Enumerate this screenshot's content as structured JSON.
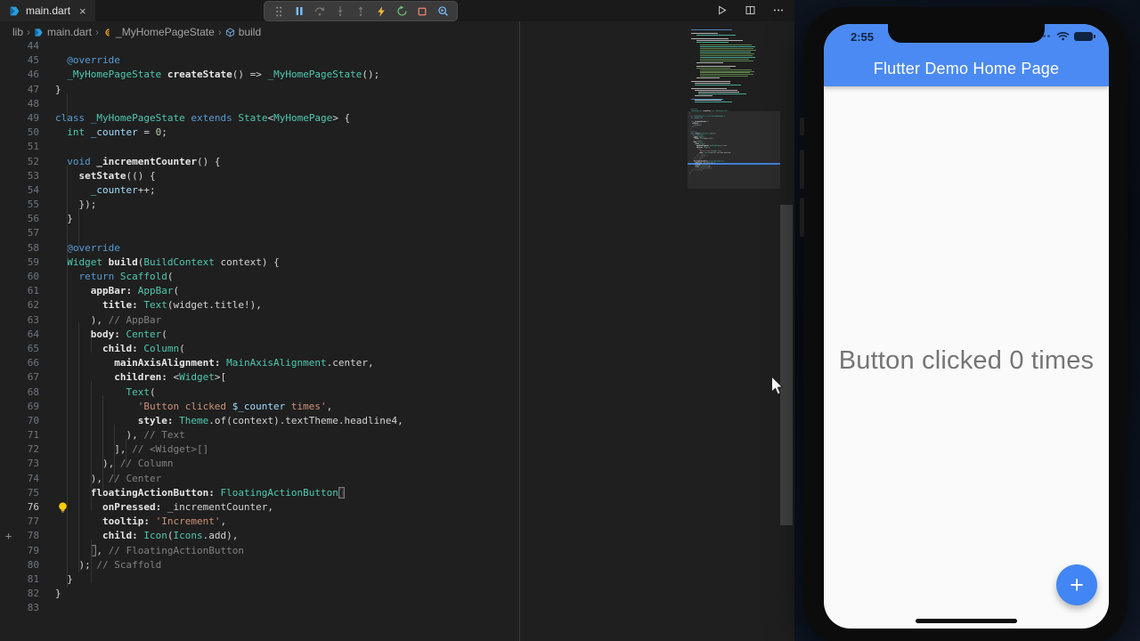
{
  "editor": {
    "tab": {
      "title": "main.dart",
      "close_label": "×"
    },
    "breadcrumbs": {
      "items": [
        "lib",
        "main.dart",
        "_MyHomePageState",
        "build"
      ],
      "separator": "›"
    },
    "debug_toolbar": {
      "buttons": [
        "drag-grip",
        "pause",
        "step-over",
        "step-into",
        "step-out",
        "hot-reload",
        "restart",
        "stop",
        "inspect-widget"
      ]
    },
    "header_actions": [
      "run",
      "split-editor",
      "more-actions"
    ],
    "gutter": {
      "plus_marker_line": 78,
      "lightbulb_line": 76,
      "active_line": 76
    },
    "code_lines": [
      {
        "n": 44,
        "t": []
      },
      {
        "n": 45,
        "t": [
          [
            "p",
            "  "
          ],
          [
            "k",
            "@override"
          ]
        ]
      },
      {
        "n": 46,
        "t": [
          [
            "p",
            "  "
          ],
          [
            "t",
            "_MyHomePageState"
          ],
          [
            "p",
            " "
          ],
          [
            "m",
            "createState"
          ],
          [
            "p",
            "() => "
          ],
          [
            "t",
            "_MyHomePageState"
          ],
          [
            "p",
            "();"
          ]
        ]
      },
      {
        "n": 47,
        "t": [
          [
            "p",
            "}"
          ]
        ]
      },
      {
        "n": 48,
        "t": []
      },
      {
        "n": 49,
        "t": [
          [
            "k",
            "class"
          ],
          [
            "p",
            " "
          ],
          [
            "t",
            "_MyHomePageState"
          ],
          [
            "p",
            " "
          ],
          [
            "k",
            "extends"
          ],
          [
            "p",
            " "
          ],
          [
            "t",
            "State"
          ],
          [
            "p",
            "<"
          ],
          [
            "t",
            "MyHomePage"
          ],
          [
            "p",
            "> {"
          ]
        ]
      },
      {
        "n": 50,
        "t": [
          [
            "p",
            "  "
          ],
          [
            "t",
            "int"
          ],
          [
            "p",
            " "
          ],
          [
            "v",
            "_counter"
          ],
          [
            "p",
            " = "
          ],
          [
            "num",
            "0"
          ],
          [
            "p",
            ";"
          ]
        ]
      },
      {
        "n": 51,
        "t": []
      },
      {
        "n": 52,
        "t": [
          [
            "p",
            "  "
          ],
          [
            "k",
            "void"
          ],
          [
            "p",
            " "
          ],
          [
            "m",
            "_incrementCounter"
          ],
          [
            "p",
            "() {"
          ]
        ]
      },
      {
        "n": 53,
        "t": [
          [
            "p",
            "    "
          ],
          [
            "m",
            "setState"
          ],
          [
            "p",
            "(() {"
          ]
        ]
      },
      {
        "n": 54,
        "t": [
          [
            "p",
            "      "
          ],
          [
            "v",
            "_counter"
          ],
          [
            "p",
            "++;"
          ]
        ]
      },
      {
        "n": 55,
        "t": [
          [
            "p",
            "    });"
          ]
        ]
      },
      {
        "n": 56,
        "t": [
          [
            "p",
            "  }"
          ]
        ]
      },
      {
        "n": 57,
        "t": []
      },
      {
        "n": 58,
        "t": [
          [
            "p",
            "  "
          ],
          [
            "k",
            "@override"
          ]
        ]
      },
      {
        "n": 59,
        "t": [
          [
            "p",
            "  "
          ],
          [
            "t",
            "Widget"
          ],
          [
            "p",
            " "
          ],
          [
            "m",
            "build"
          ],
          [
            "p",
            "("
          ],
          [
            "t",
            "BuildContext"
          ],
          [
            "p",
            " context) {"
          ]
        ]
      },
      {
        "n": 60,
        "t": [
          [
            "p",
            "    "
          ],
          [
            "k",
            "return"
          ],
          [
            "p",
            " "
          ],
          [
            "t",
            "Scaffold"
          ],
          [
            "p",
            "("
          ]
        ]
      },
      {
        "n": 61,
        "t": [
          [
            "p",
            "      "
          ],
          [
            "n",
            "appBar:"
          ],
          [
            "p",
            " "
          ],
          [
            "t",
            "AppBar"
          ],
          [
            "p",
            "("
          ]
        ]
      },
      {
        "n": 62,
        "t": [
          [
            "p",
            "        "
          ],
          [
            "n",
            "title:"
          ],
          [
            "p",
            " "
          ],
          [
            "t",
            "Text"
          ],
          [
            "p",
            "(widget.title!),"
          ]
        ]
      },
      {
        "n": 63,
        "t": [
          [
            "p",
            "      ), "
          ],
          [
            "c",
            "// AppBar"
          ]
        ]
      },
      {
        "n": 64,
        "t": [
          [
            "p",
            "      "
          ],
          [
            "n",
            "body:"
          ],
          [
            "p",
            " "
          ],
          [
            "t",
            "Center"
          ],
          [
            "p",
            "("
          ]
        ]
      },
      {
        "n": 65,
        "t": [
          [
            "p",
            "        "
          ],
          [
            "n",
            "child:"
          ],
          [
            "p",
            " "
          ],
          [
            "t",
            "Column"
          ],
          [
            "p",
            "("
          ]
        ]
      },
      {
        "n": 66,
        "t": [
          [
            "p",
            "          "
          ],
          [
            "n",
            "mainAxisAlignment:"
          ],
          [
            "p",
            " "
          ],
          [
            "t",
            "MainAxisAlignment"
          ],
          [
            "p",
            ".center,"
          ]
        ]
      },
      {
        "n": 67,
        "t": [
          [
            "p",
            "          "
          ],
          [
            "n",
            "children:"
          ],
          [
            "p",
            " <"
          ],
          [
            "t",
            "Widget"
          ],
          [
            "p",
            ">["
          ]
        ]
      },
      {
        "n": 68,
        "t": [
          [
            "p",
            "            "
          ],
          [
            "t",
            "Text"
          ],
          [
            "p",
            "("
          ]
        ]
      },
      {
        "n": 69,
        "t": [
          [
            "p",
            "              "
          ],
          [
            "s",
            "'Button clicked "
          ],
          [
            "i",
            "$_counter"
          ],
          [
            "s",
            " times'"
          ],
          [
            "p",
            ","
          ]
        ]
      },
      {
        "n": 70,
        "t": [
          [
            "p",
            "              "
          ],
          [
            "n",
            "style:"
          ],
          [
            "p",
            " "
          ],
          [
            "t",
            "Theme"
          ],
          [
            "p",
            ".of(context).textTheme.headline4,"
          ]
        ]
      },
      {
        "n": 71,
        "t": [
          [
            "p",
            "            ), "
          ],
          [
            "c",
            "// Text"
          ]
        ]
      },
      {
        "n": 72,
        "t": [
          [
            "p",
            "          ], "
          ],
          [
            "c",
            "// <Widget>[]"
          ]
        ]
      },
      {
        "n": 73,
        "t": [
          [
            "p",
            "        ), "
          ],
          [
            "c",
            "// Column"
          ]
        ]
      },
      {
        "n": 74,
        "t": [
          [
            "p",
            "      ), "
          ],
          [
            "c",
            "// Center"
          ]
        ]
      },
      {
        "n": 75,
        "t": [
          [
            "p",
            "      "
          ],
          [
            "n",
            "floatingActionButton:"
          ],
          [
            "p",
            " "
          ],
          [
            "t",
            "FloatingActionButton"
          ],
          [
            "bm",
            "("
          ]
        ]
      },
      {
        "n": 76,
        "t": [
          [
            "p",
            "        "
          ],
          [
            "n",
            "onPressed:"
          ],
          [
            "p",
            " _incrementCounter,"
          ]
        ]
      },
      {
        "n": 77,
        "t": [
          [
            "p",
            "        "
          ],
          [
            "n",
            "tooltip:"
          ],
          [
            "p",
            " "
          ],
          [
            "s",
            "'Increment'"
          ],
          [
            "p",
            ","
          ]
        ]
      },
      {
        "n": 78,
        "t": [
          [
            "p",
            "        "
          ],
          [
            "n",
            "child:"
          ],
          [
            "p",
            " "
          ],
          [
            "t",
            "Icon"
          ],
          [
            "p",
            "("
          ],
          [
            "t",
            "Icons"
          ],
          [
            "p",
            ".add),"
          ]
        ]
      },
      {
        "n": 79,
        "t": [
          [
            "p",
            "      "
          ],
          [
            "bm",
            ")"
          ],
          [
            "p",
            ", "
          ],
          [
            "c",
            "// FloatingActionButton"
          ]
        ]
      },
      {
        "n": 80,
        "t": [
          [
            "p",
            "    ); "
          ],
          [
            "c",
            "// Scaffold"
          ]
        ]
      },
      {
        "n": 81,
        "t": [
          [
            "p",
            "  }"
          ]
        ]
      },
      {
        "n": 82,
        "t": [
          [
            "p",
            "}"
          ]
        ]
      },
      {
        "n": 83,
        "t": []
      }
    ]
  },
  "simulator": {
    "status_time": "2:55",
    "app_bar_title": "Flutter Demo Home Page",
    "body_text": "Button clicked 0 times",
    "fab_label": "+"
  },
  "colors": {
    "app-bar": "#4b8af2",
    "fab": "#4285f4",
    "keyword": "#569cd6",
    "type": "#4ec9b0",
    "string": "#ce9178",
    "comment": "#818181",
    "interp": "#9cdcfe",
    "number": "#b5cea8"
  }
}
